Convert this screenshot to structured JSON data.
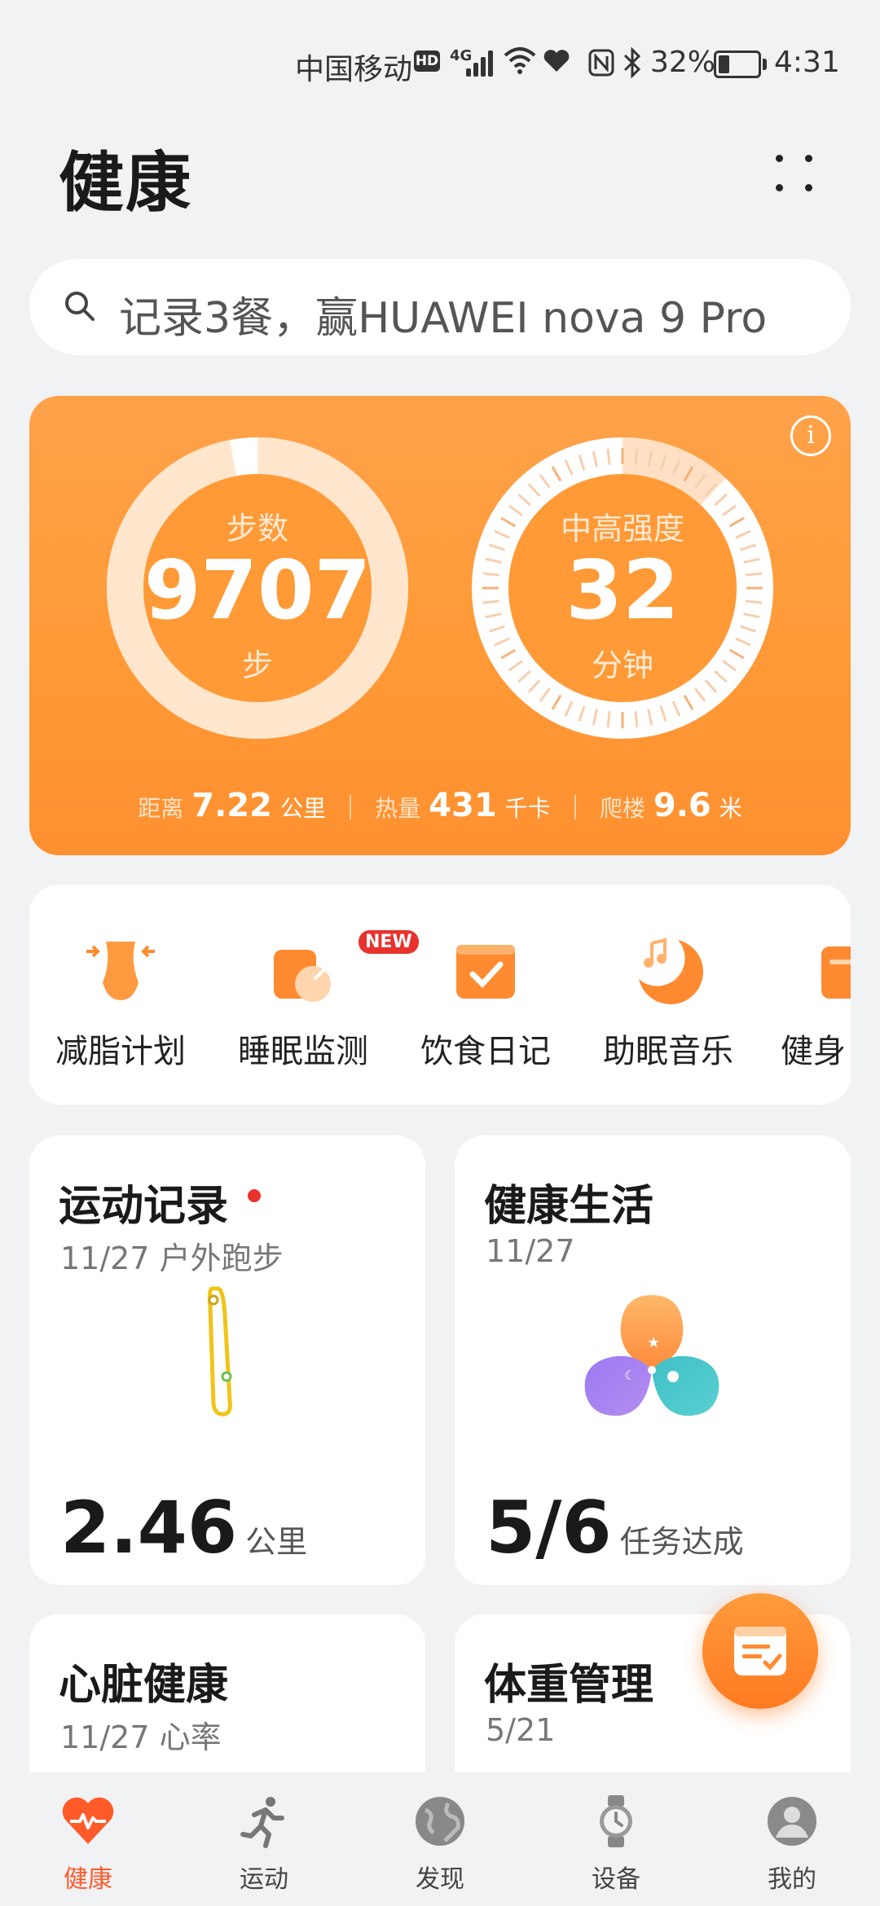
{
  "status_bar": {
    "carrier": "中国移动",
    "hd": "HD",
    "network": "4G",
    "battery_percent": "32%",
    "battery_level": 0.32,
    "time": "4:31"
  },
  "header": {
    "title": "健康"
  },
  "search": {
    "placeholder": "记录3餐，赢HUAWEI nova 9 Pro"
  },
  "activity": {
    "steps": {
      "label": "步数",
      "value": "9707",
      "unit": "步",
      "progress": 0.97
    },
    "intensity": {
      "label": "中高强度",
      "value": "32",
      "unit": "分钟",
      "progress": 0.12
    },
    "stats": [
      {
        "label": "距离",
        "value": "7.22",
        "unit": "公里"
      },
      {
        "label": "热量",
        "value": "431",
        "unit": "千卡"
      },
      {
        "label": "爬楼",
        "value": "9.6",
        "unit": "米"
      }
    ],
    "colors": {
      "card": "#ff9a36",
      "ring": "#ffffff"
    }
  },
  "quick_actions": [
    {
      "label": "减脂计划",
      "icon": "waist-icon"
    },
    {
      "label": "睡眠监测",
      "icon": "sleep-monitor-icon",
      "badge": "NEW"
    },
    {
      "label": "饮食日记",
      "icon": "calendar-check-icon"
    },
    {
      "label": "助眠音乐",
      "icon": "moon-music-icon"
    },
    {
      "label": "健身",
      "icon": "fitness-icon"
    }
  ],
  "cards": {
    "exercise": {
      "title": "运动记录",
      "subtitle": "11/27 户外跑步",
      "value": "2.46",
      "unit": "公里"
    },
    "healthy_life": {
      "title": "健康生活",
      "subtitle": "11/27",
      "value": "5/6",
      "unit": "任务达成"
    },
    "heart": {
      "title": "心脏健康",
      "subtitle": "11/27 心率"
    },
    "weight": {
      "title": "体重管理",
      "subtitle": "5/21"
    }
  },
  "bottom_nav": [
    {
      "label": "健康",
      "icon": "heart-pulse-icon",
      "active": true
    },
    {
      "label": "运动",
      "icon": "running-icon",
      "active": false
    },
    {
      "label": "发现",
      "icon": "globe-icon",
      "active": false
    },
    {
      "label": "设备",
      "icon": "watch-icon",
      "active": false
    },
    {
      "label": "我的",
      "icon": "profile-icon",
      "active": false
    }
  ],
  "accent_color": "#ff5a2a"
}
